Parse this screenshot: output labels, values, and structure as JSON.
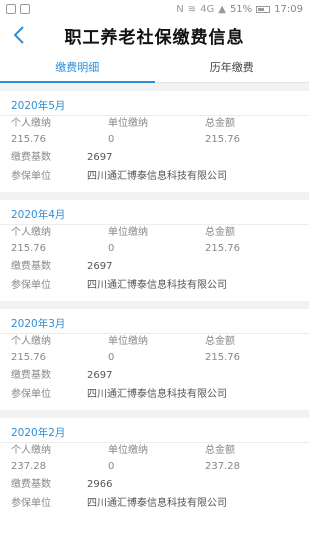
{
  "statusbar": {
    "battery": "51%",
    "time": "17:09",
    "signal": "4G"
  },
  "header": {
    "title": "职工养老社保缴费信息"
  },
  "tabs": [
    {
      "label": "缴费明细",
      "active": true
    },
    {
      "label": "历年缴费",
      "active": false
    }
  ],
  "labels": {
    "personal": "个人缴纳",
    "unit": "单位缴纳",
    "total": "总金额",
    "base": "缴费基数",
    "insured_unit": "参保单位"
  },
  "records": [
    {
      "month": "2020年5月",
      "personal": "215.76",
      "unit": "0",
      "total": "215.76",
      "base": "2697",
      "company": "四川通汇博泰信息科技有限公司"
    },
    {
      "month": "2020年4月",
      "personal": "215.76",
      "unit": "0",
      "total": "215.76",
      "base": "2697",
      "company": "四川通汇博泰信息科技有限公司"
    },
    {
      "month": "2020年3月",
      "personal": "215.76",
      "unit": "0",
      "total": "215.76",
      "base": "2697",
      "company": "四川通汇博泰信息科技有限公司"
    },
    {
      "month": "2020年2月",
      "personal": "237.28",
      "unit": "0",
      "total": "237.28",
      "base": "2966",
      "company": "四川通汇博泰信息科技有限公司"
    }
  ],
  "colors": {
    "accent": "#2f8fd6"
  }
}
